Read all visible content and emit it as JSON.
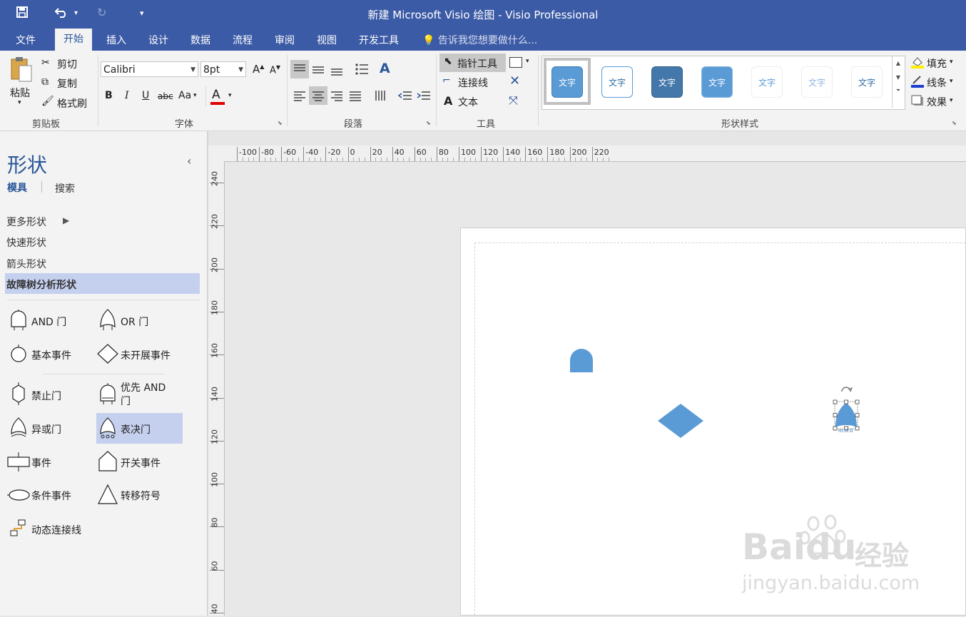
{
  "title_bar": {
    "title": "新建 Microsoft Visio 绘图 - Visio Professional"
  },
  "tabs": [
    "文件",
    "开始",
    "插入",
    "设计",
    "数据",
    "流程",
    "审阅",
    "视图",
    "开发工具"
  ],
  "tell_me": "告诉我您想要做什么...",
  "clipboard": {
    "paste": "粘贴",
    "cut": "剪切",
    "copy": "复制",
    "format_painter": "格式刷",
    "label": "剪贴板"
  },
  "font": {
    "name": "Calibri",
    "size": "8pt",
    "bold": "B",
    "italic": "I",
    "underline": "U",
    "strike": "abc",
    "case": "Aa",
    "color_glyph": "A",
    "label": "字体"
  },
  "paragraph": {
    "label": "段落"
  },
  "tools": {
    "pointer": "指针工具",
    "connector": "连接线",
    "text": "文本",
    "label": "工具"
  },
  "shape_styles": {
    "sample": "文字",
    "label": "形状样式",
    "fill": "填充",
    "line": "线条",
    "effects": "效果"
  },
  "colors": {
    "accent": "#3c5ba6",
    "shape_blue": "#5b9bd5",
    "highlight": "#c5d0ef"
  },
  "shapes_pane": {
    "title": "形状",
    "tab_stencils": "模具",
    "tab_search": "搜索",
    "more_shapes": "更多形状",
    "quick_shapes": "快速形状",
    "arrow_shapes": "箭头形状",
    "fta_shapes": "故障树分析形状",
    "stencil_items": [
      "AND 门",
      "OR 门",
      "基本事件",
      "未开展事件",
      "禁止门",
      "优先 AND 门",
      "异或门",
      "表决门",
      "事件",
      "开关事件",
      "条件事件",
      "转移符号",
      "动态连接线"
    ]
  },
  "ruler": {
    "h_ticks": [
      "-100",
      "-80",
      "-60",
      "-40",
      "-20",
      "0",
      "20",
      "40",
      "60",
      "80",
      "100",
      "120",
      "140",
      "160",
      "180",
      "200",
      "220"
    ],
    "v_ticks": [
      "240",
      "220",
      "200",
      "180",
      "160",
      "140",
      "120",
      "100",
      "80",
      "60",
      "40"
    ]
  },
  "canvas": {
    "selected_label": "m:0:0"
  },
  "watermark": {
    "brand": "Baidu",
    "brand_cn": "经验",
    "url": "jingyan.baidu.com"
  }
}
